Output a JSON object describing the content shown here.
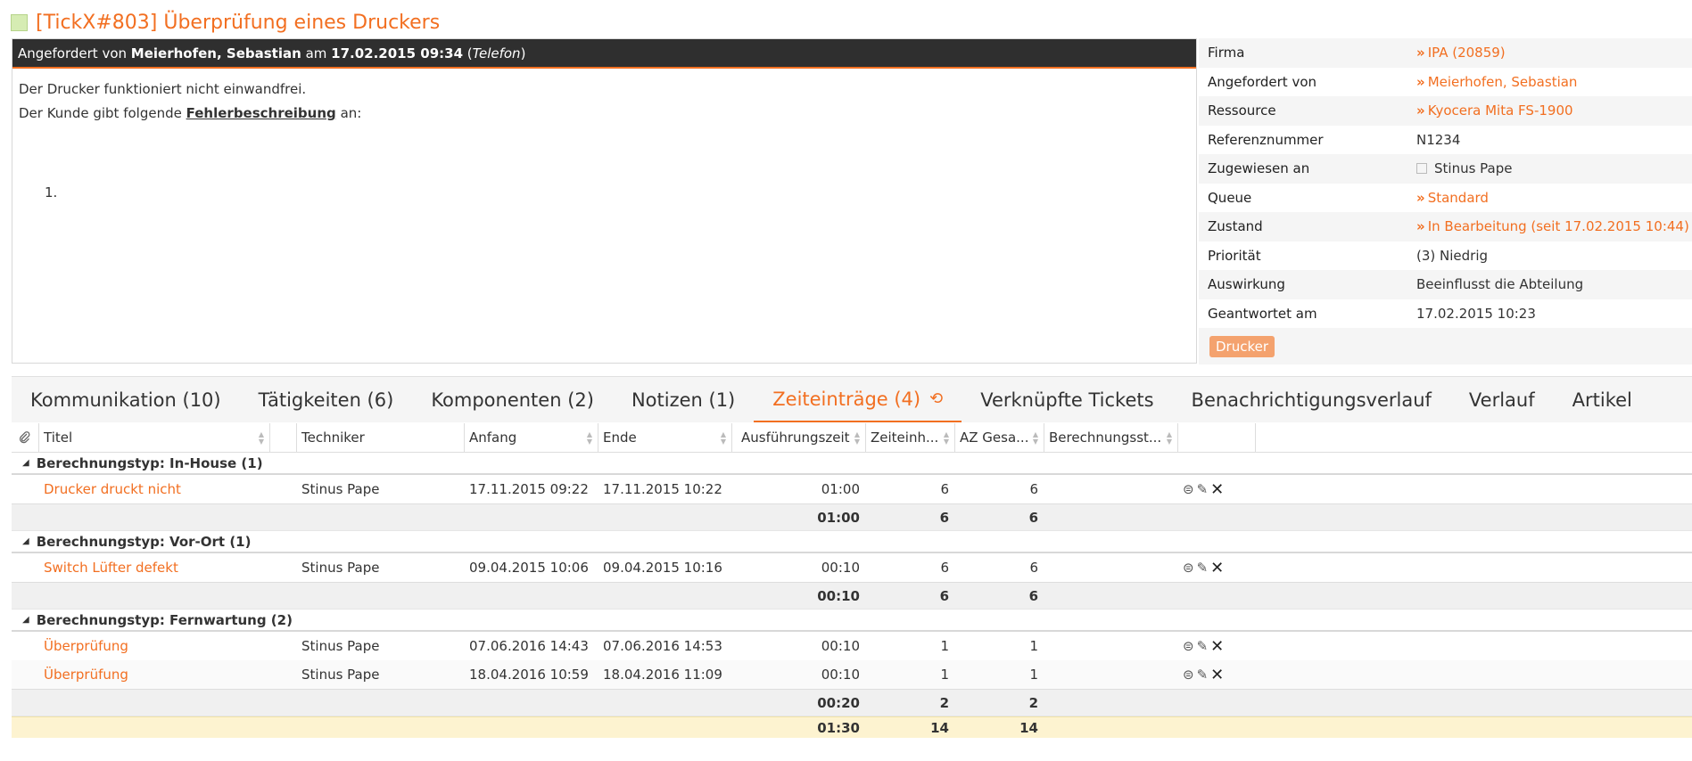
{
  "ticket": {
    "title": "[TickX#803] Überprüfung eines Druckers",
    "status_color": "#d6ecb3"
  },
  "request": {
    "prefix": "Angefordert von",
    "requester": "Meierhofen, Sebastian",
    "at": "am",
    "date": "17.02.2015 09:34",
    "channel": "Telefon"
  },
  "description": {
    "line1": "Der Drucker funktioniert nicht einwandfrei.",
    "line2_pre": "Der Kunde gibt folgende",
    "line2_bold": "Fehlerbeschreibung",
    "line2_post": "an:",
    "list_item": "1."
  },
  "properties": [
    {
      "key": "Firma",
      "value": "IPA (20859)",
      "link": true
    },
    {
      "key": "Angefordert von",
      "value": "Meierhofen, Sebastian",
      "link": true
    },
    {
      "key": "Ressource",
      "value": "Kyocera Mita FS-1900",
      "link": true
    },
    {
      "key": "Referenznummer",
      "value": "N1234",
      "link": false
    },
    {
      "key": "Zugewiesen an",
      "value": "Stinus Pape",
      "link": false
    },
    {
      "key": "Queue",
      "value": "Standard",
      "link": true
    },
    {
      "key": "Zustand",
      "value": "In Bearbeitung (seit 17.02.2015 10:44)",
      "link": true
    },
    {
      "key": "Priorität",
      "value": "(3) Niedrig",
      "link": false
    },
    {
      "key": "Auswirkung",
      "value": "Beeinflusst die Abteilung",
      "link": false
    },
    {
      "key": "Geantwortet am",
      "value": "17.02.2015 10:23",
      "link": false
    }
  ],
  "tag": "Drucker",
  "tabs": [
    "Kommunikation (10)",
    "Tätigkeiten (6)",
    "Komponenten (2)",
    "Notizen (1)",
    "Zeiteinträge (4)",
    "Verknüpfte Tickets",
    "Benachrichtigungsverlauf",
    "Verlauf",
    "Artikel"
  ],
  "columns": [
    "Titel",
    "Techniker",
    "Anfang",
    "Ende",
    "Ausführungszeit",
    "Zeiteinh...",
    "AZ Gesa...",
    "Berechnungsst..."
  ],
  "groups": [
    {
      "label": "Berechnungstyp: In-House (1)",
      "rows": [
        {
          "titel": "Drucker druckt nicht",
          "techniker": "Stinus Pape",
          "anfang": "17.11.2015 09:22",
          "ende": "17.11.2015 10:22",
          "zeit": "01:00",
          "einh": "6",
          "az": "6"
        }
      ],
      "sum": {
        "zeit": "01:00",
        "einh": "6",
        "az": "6"
      }
    },
    {
      "label": "Berechnungstyp: Vor-Ort (1)",
      "rows": [
        {
          "titel": "Switch Lüfter defekt",
          "techniker": "Stinus Pape",
          "anfang": "09.04.2015 10:06",
          "ende": "09.04.2015 10:16",
          "zeit": "00:10",
          "einh": "6",
          "az": "6"
        }
      ],
      "sum": {
        "zeit": "00:10",
        "einh": "6",
        "az": "6"
      }
    },
    {
      "label": "Berechnungstyp: Fernwartung (2)",
      "rows": [
        {
          "titel": "Überprüfung",
          "techniker": "Stinus Pape",
          "anfang": "07.06.2016 14:43",
          "ende": "07.06.2016 14:53",
          "zeit": "00:10",
          "einh": "1",
          "az": "1"
        },
        {
          "titel": "Überprüfung",
          "techniker": "Stinus Pape",
          "anfang": "18.04.2016 10:59",
          "ende": "18.04.2016 11:09",
          "zeit": "00:10",
          "einh": "1",
          "az": "1"
        }
      ],
      "sum": {
        "zeit": "00:20",
        "einh": "2",
        "az": "2"
      }
    }
  ],
  "total": {
    "zeit": "01:30",
    "einh": "14",
    "az": "14"
  },
  "colors": {
    "accent": "#f26f21",
    "header_dark": "#2f2f2f",
    "total_bg": "#fdf3d0"
  }
}
